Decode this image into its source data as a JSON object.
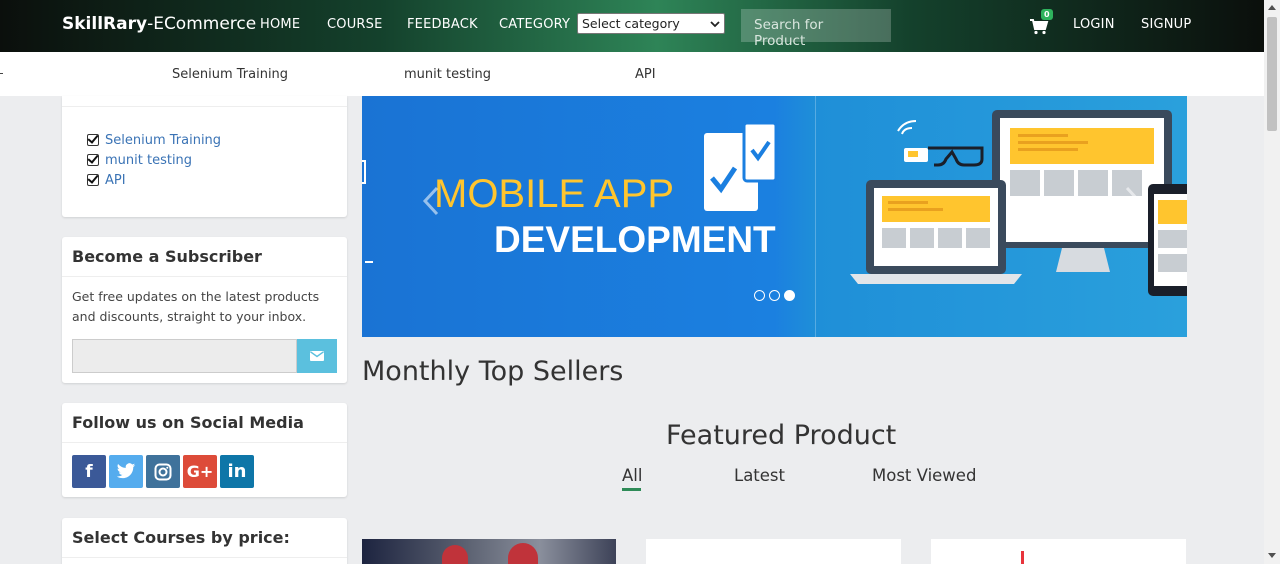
{
  "brand": {
    "bold": "SkillRary",
    "rest": "-ECommerce"
  },
  "nav": {
    "home": "HOME",
    "course": "COURSE",
    "feedback": "FEEDBACK",
    "category": "CATEGORY",
    "category_select": "Select category",
    "search_placeholder": "Search for Product",
    "cart_count": "0",
    "login": "LOGIN",
    "signup": "SIGNUP"
  },
  "subnav": {
    "items": [
      "Selenium Training",
      "munit testing",
      "API"
    ]
  },
  "sidebar": {
    "categories": [
      "Selenium Training",
      "munit testing",
      "API"
    ],
    "subscriber": {
      "title": "Become a Subscriber",
      "text": "Get free updates on the latest products and discounts, straight to your inbox."
    },
    "social": {
      "title": "Follow us on Social Media",
      "icons": [
        "facebook-icon",
        "twitter-icon",
        "instagram-icon",
        "google-plus-icon",
        "linkedin-icon"
      ]
    },
    "price": {
      "title": "Select Courses by price:"
    }
  },
  "carousel": {
    "title_line1": "MOBILE APP",
    "title_line2": "DEVELOPMENT",
    "slide_count": 3,
    "active_slide": 3
  },
  "main": {
    "monthly_title": "Monthly Top Sellers",
    "featured_title": "Featured Product",
    "tabs": [
      "All",
      "Latest",
      "Most Viewed"
    ],
    "active_tab": "All"
  },
  "colors": {
    "accent": "#2e8b57",
    "link": "#3a73b5",
    "subscribe_button": "#5bc0de",
    "facebook": "#3b5998",
    "twitter": "#55acee",
    "instagram": "#3f729b",
    "google_plus": "#dd4b39",
    "linkedin": "#0e76a8"
  }
}
